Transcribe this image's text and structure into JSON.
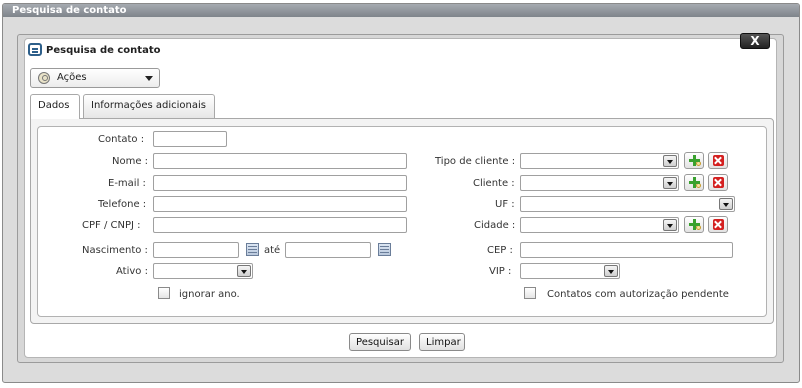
{
  "window": {
    "title": "Pesquisa de contato"
  },
  "dialog": {
    "title": "Pesquisa de contato",
    "close_label": "X"
  },
  "actions_menu": {
    "label": "Ações"
  },
  "tabs": [
    {
      "label": "Dados",
      "active": true
    },
    {
      "label": "Informações adicionais",
      "active": false
    }
  ],
  "form": {
    "contato": {
      "label": "Contato :",
      "value": ""
    },
    "nome": {
      "label": "Nome :",
      "value": ""
    },
    "email": {
      "label": "E-mail :",
      "value": ""
    },
    "telefone": {
      "label": "Telefone :",
      "value": ""
    },
    "cpf_cnpj": {
      "label": "CPF / CNPJ :",
      "value": ""
    },
    "nascimento": {
      "label": "Nascimento :",
      "from": "",
      "connector": "até",
      "to": ""
    },
    "ativo": {
      "label": "Ativo :",
      "value": ""
    },
    "ignorar_ano": {
      "label": "ignorar ano.",
      "checked": false
    },
    "tipo_cliente": {
      "label": "Tipo de cliente :",
      "value": ""
    },
    "cliente": {
      "label": "Cliente :",
      "value": ""
    },
    "uf": {
      "label": "UF :",
      "value": ""
    },
    "cidade": {
      "label": "Cidade :",
      "value": ""
    },
    "cep": {
      "label": "CEP :",
      "value": ""
    },
    "vip": {
      "label": "VIP :",
      "value": ""
    },
    "autorizacao_pendente": {
      "label": "Contatos com autorização pendente",
      "checked": false
    }
  },
  "buttons": {
    "search": "Pesquisar",
    "clear": "Limpar"
  },
  "icons": {
    "add": "add-search-icon",
    "remove": "remove-icon",
    "calendar": "calendar-icon"
  }
}
